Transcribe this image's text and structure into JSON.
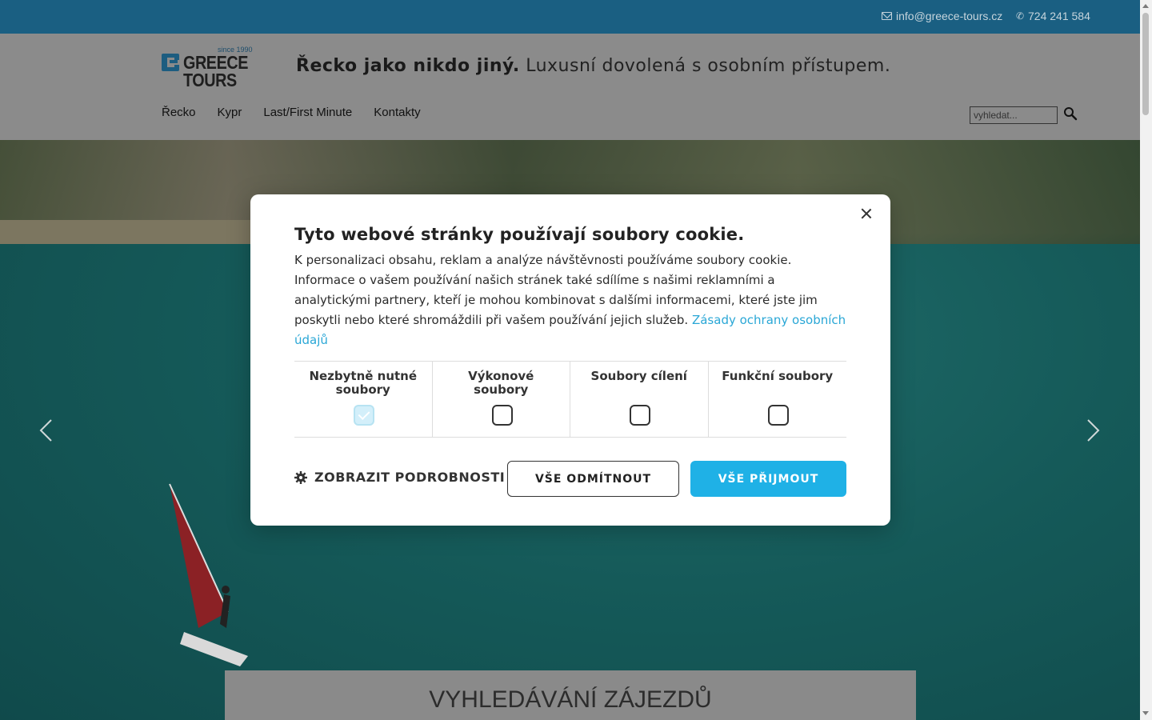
{
  "topbar": {
    "email": "info@greece-tours.cz",
    "phone": "724 241 584"
  },
  "header": {
    "logo": {
      "since": "since 1990",
      "line1": "GREECE",
      "line2": "TOURS"
    },
    "tagline_bold": "Řecko jako nikdo jiný.",
    "tagline_light": "Luxusní dovolená s osobním přístupem.",
    "nav": [
      "Řecko",
      "Kypr",
      "Last/First Minute",
      "Kontakty"
    ],
    "search_placeholder": "vyhledat..."
  },
  "hero": {
    "search_panel_title": "VYHLEDÁVÁNÍ ZÁJEZDŮ"
  },
  "cookie_modal": {
    "title": "Tyto webové stránky používají soubory cookie.",
    "body": "K personalizaci obsahu, reklam a analýze návštěvnosti používáme soubory cookie. Informace o vašem používání našich stránek také sdílíme s našimi reklamními a analytickými partnery, kteří je mohou kombinovat s dalšími informacemi, které jste jim poskytli nebo které shromáždili při vašem používání jejich služeb.",
    "privacy_link": "Zásady ochrany osobních údajů",
    "categories": [
      {
        "label": "Nezbytně nutné soubory",
        "checked": true
      },
      {
        "label": "Výkonové soubory",
        "checked": false
      },
      {
        "label": "Soubory cílení",
        "checked": false
      },
      {
        "label": "Funkční soubory",
        "checked": false
      }
    ],
    "details_label": "ZOBRAZIT PODROBNOSTI",
    "reject_label": "VŠE ODMÍTNOUT",
    "accept_label": "VŠE PŘIJMOUT"
  },
  "colors": {
    "topbar": "#1a5f82",
    "accent": "#1fb1e6",
    "link": "#2aa7d6"
  }
}
